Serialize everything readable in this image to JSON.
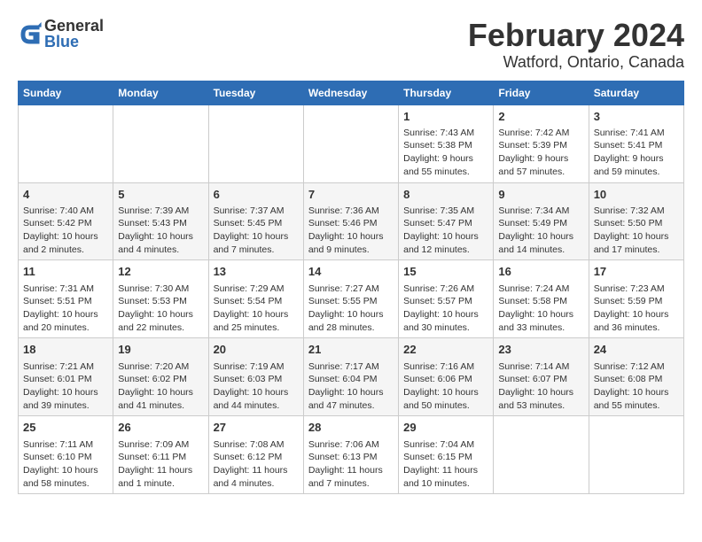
{
  "app": {
    "name": "GeneralBlue",
    "logo_text_1": "General",
    "logo_text_2": "Blue"
  },
  "title": "February 2024",
  "subtitle": "Watford, Ontario, Canada",
  "days_of_week": [
    "Sunday",
    "Monday",
    "Tuesday",
    "Wednesday",
    "Thursday",
    "Friday",
    "Saturday"
  ],
  "weeks": [
    {
      "days": [
        {
          "num": "",
          "info": ""
        },
        {
          "num": "",
          "info": ""
        },
        {
          "num": "",
          "info": ""
        },
        {
          "num": "",
          "info": ""
        },
        {
          "num": "1",
          "info": "Sunrise: 7:43 AM\nSunset: 5:38 PM\nDaylight: 9 hours\nand 55 minutes."
        },
        {
          "num": "2",
          "info": "Sunrise: 7:42 AM\nSunset: 5:39 PM\nDaylight: 9 hours\nand 57 minutes."
        },
        {
          "num": "3",
          "info": "Sunrise: 7:41 AM\nSunset: 5:41 PM\nDaylight: 9 hours\nand 59 minutes."
        }
      ]
    },
    {
      "days": [
        {
          "num": "4",
          "info": "Sunrise: 7:40 AM\nSunset: 5:42 PM\nDaylight: 10 hours\nand 2 minutes."
        },
        {
          "num": "5",
          "info": "Sunrise: 7:39 AM\nSunset: 5:43 PM\nDaylight: 10 hours\nand 4 minutes."
        },
        {
          "num": "6",
          "info": "Sunrise: 7:37 AM\nSunset: 5:45 PM\nDaylight: 10 hours\nand 7 minutes."
        },
        {
          "num": "7",
          "info": "Sunrise: 7:36 AM\nSunset: 5:46 PM\nDaylight: 10 hours\nand 9 minutes."
        },
        {
          "num": "8",
          "info": "Sunrise: 7:35 AM\nSunset: 5:47 PM\nDaylight: 10 hours\nand 12 minutes."
        },
        {
          "num": "9",
          "info": "Sunrise: 7:34 AM\nSunset: 5:49 PM\nDaylight: 10 hours\nand 14 minutes."
        },
        {
          "num": "10",
          "info": "Sunrise: 7:32 AM\nSunset: 5:50 PM\nDaylight: 10 hours\nand 17 minutes."
        }
      ]
    },
    {
      "days": [
        {
          "num": "11",
          "info": "Sunrise: 7:31 AM\nSunset: 5:51 PM\nDaylight: 10 hours\nand 20 minutes."
        },
        {
          "num": "12",
          "info": "Sunrise: 7:30 AM\nSunset: 5:53 PM\nDaylight: 10 hours\nand 22 minutes."
        },
        {
          "num": "13",
          "info": "Sunrise: 7:29 AM\nSunset: 5:54 PM\nDaylight: 10 hours\nand 25 minutes."
        },
        {
          "num": "14",
          "info": "Sunrise: 7:27 AM\nSunset: 5:55 PM\nDaylight: 10 hours\nand 28 minutes."
        },
        {
          "num": "15",
          "info": "Sunrise: 7:26 AM\nSunset: 5:57 PM\nDaylight: 10 hours\nand 30 minutes."
        },
        {
          "num": "16",
          "info": "Sunrise: 7:24 AM\nSunset: 5:58 PM\nDaylight: 10 hours\nand 33 minutes."
        },
        {
          "num": "17",
          "info": "Sunrise: 7:23 AM\nSunset: 5:59 PM\nDaylight: 10 hours\nand 36 minutes."
        }
      ]
    },
    {
      "days": [
        {
          "num": "18",
          "info": "Sunrise: 7:21 AM\nSunset: 6:01 PM\nDaylight: 10 hours\nand 39 minutes."
        },
        {
          "num": "19",
          "info": "Sunrise: 7:20 AM\nSunset: 6:02 PM\nDaylight: 10 hours\nand 41 minutes."
        },
        {
          "num": "20",
          "info": "Sunrise: 7:19 AM\nSunset: 6:03 PM\nDaylight: 10 hours\nand 44 minutes."
        },
        {
          "num": "21",
          "info": "Sunrise: 7:17 AM\nSunset: 6:04 PM\nDaylight: 10 hours\nand 47 minutes."
        },
        {
          "num": "22",
          "info": "Sunrise: 7:16 AM\nSunset: 6:06 PM\nDaylight: 10 hours\nand 50 minutes."
        },
        {
          "num": "23",
          "info": "Sunrise: 7:14 AM\nSunset: 6:07 PM\nDaylight: 10 hours\nand 53 minutes."
        },
        {
          "num": "24",
          "info": "Sunrise: 7:12 AM\nSunset: 6:08 PM\nDaylight: 10 hours\nand 55 minutes."
        }
      ]
    },
    {
      "days": [
        {
          "num": "25",
          "info": "Sunrise: 7:11 AM\nSunset: 6:10 PM\nDaylight: 10 hours\nand 58 minutes."
        },
        {
          "num": "26",
          "info": "Sunrise: 7:09 AM\nSunset: 6:11 PM\nDaylight: 11 hours\nand 1 minute."
        },
        {
          "num": "27",
          "info": "Sunrise: 7:08 AM\nSunset: 6:12 PM\nDaylight: 11 hours\nand 4 minutes."
        },
        {
          "num": "28",
          "info": "Sunrise: 7:06 AM\nSunset: 6:13 PM\nDaylight: 11 hours\nand 7 minutes."
        },
        {
          "num": "29",
          "info": "Sunrise: 7:04 AM\nSunset: 6:15 PM\nDaylight: 11 hours\nand 10 minutes."
        },
        {
          "num": "",
          "info": ""
        },
        {
          "num": "",
          "info": ""
        }
      ]
    }
  ]
}
